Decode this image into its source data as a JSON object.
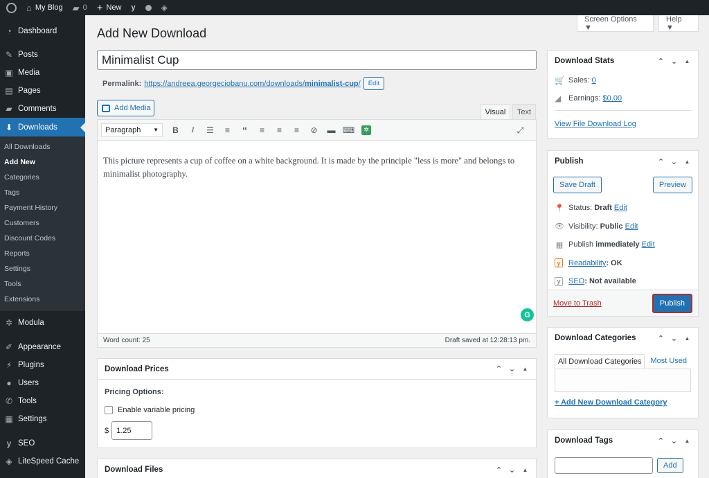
{
  "adminbar": {
    "site_name": "My Blog",
    "comments_count": "0",
    "new_label": "New"
  },
  "sidebar": {
    "items": [
      {
        "label": "Dashboard",
        "icon": "dashboard-icon"
      },
      {
        "label": "Posts",
        "icon": "pin-icon"
      },
      {
        "label": "Media",
        "icon": "media-icon"
      },
      {
        "label": "Pages",
        "icon": "pages-icon"
      },
      {
        "label": "Comments",
        "icon": "comments-icon"
      },
      {
        "label": "Downloads",
        "icon": "download-icon"
      },
      {
        "label": "Modula",
        "icon": "gear-icon"
      },
      {
        "label": "Appearance",
        "icon": "brush-icon"
      },
      {
        "label": "Plugins",
        "icon": "plugin-icon"
      },
      {
        "label": "Users",
        "icon": "user-icon"
      },
      {
        "label": "Tools",
        "icon": "wrench-icon"
      },
      {
        "label": "Settings",
        "icon": "settings-icon"
      },
      {
        "label": "SEO",
        "icon": "yoast-icon"
      },
      {
        "label": "LiteSpeed Cache",
        "icon": "diamond-icon"
      }
    ],
    "submenu": [
      "All Downloads",
      "Add New",
      "Categories",
      "Tags",
      "Payment History",
      "Customers",
      "Discount Codes",
      "Reports",
      "Settings",
      "Tools",
      "Extensions"
    ]
  },
  "header": {
    "screen_options": "Screen Options ▼",
    "help": "Help ▼",
    "title": "Add New Download"
  },
  "editor": {
    "title_value": "Minimalist Cup",
    "permalink_label": "Permalink:",
    "permalink_base": "https://andreea.georgeciobanu.com/downloads/",
    "permalink_slug": "minimalist-cup",
    "permalink_tail": "/",
    "edit_label": "Edit",
    "add_media": "Add Media",
    "tab_visual": "Visual",
    "tab_text": "Text",
    "format": "Paragraph",
    "body": "This picture represents a cup of coffee on a white background. It is made by the principle \"less is more\" and belongs to minimalist photography.",
    "word_count": "Word count: 25",
    "draft_saved": "Draft saved at 12:28:13 pm."
  },
  "prices": {
    "title": "Download Prices",
    "pricing_options": "Pricing Options:",
    "enable_variable": "Enable variable pricing",
    "currency": "$",
    "price_value": "1.25"
  },
  "files": {
    "title": "Download Files"
  },
  "stats": {
    "title": "Download Stats",
    "sales_label": "Sales:",
    "sales_value": "0",
    "earnings_label": "Earnings:",
    "earnings_value": "$0.00",
    "log_link": "View File Download Log"
  },
  "publish": {
    "title": "Publish",
    "save_draft": "Save Draft",
    "preview": "Preview",
    "status_label": "Status:",
    "status_value": "Draft",
    "visibility_label": "Visibility:",
    "visibility_value": "Public",
    "publish_label": "Publish",
    "publish_value": "immediately",
    "readability_label": "Readability",
    "readability_value": ": OK",
    "seo_label": "SEO",
    "seo_value": ": Not available",
    "edit": "Edit",
    "trash": "Move to Trash",
    "publish_button": "Publish"
  },
  "categories": {
    "title": "Download Categories",
    "tab_all": "All Download Categories",
    "tab_used": "Most Used",
    "add_new": "+ Add New Download Category"
  },
  "tags": {
    "title": "Download Tags",
    "add": "Add"
  }
}
